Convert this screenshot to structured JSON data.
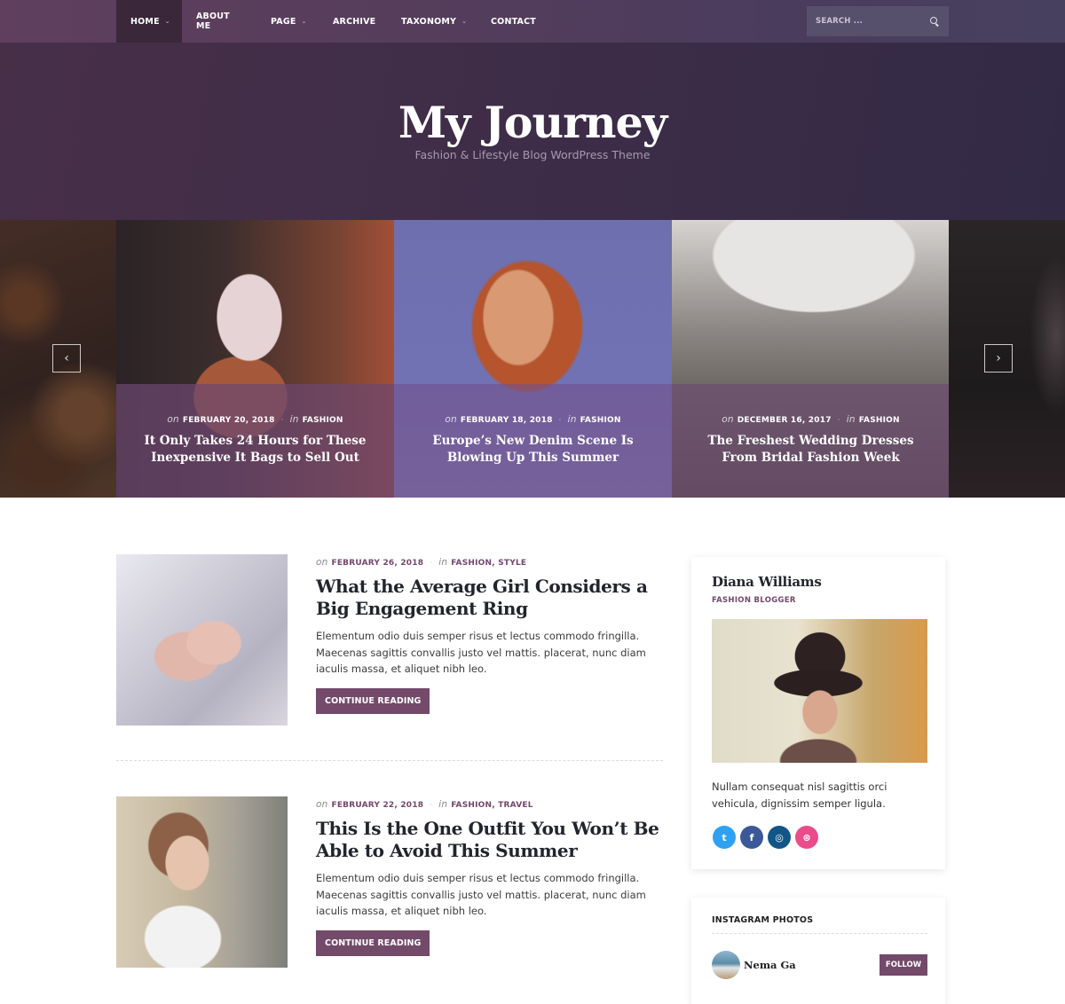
{
  "nav": {
    "items": [
      {
        "label": "HOME",
        "dropdown": true,
        "active": true
      },
      {
        "label": "ABOUT ME",
        "dropdown": false
      },
      {
        "label": "PAGE",
        "dropdown": true
      },
      {
        "label": "ARCHIVE",
        "dropdown": false
      },
      {
        "label": "TAXONOMY",
        "dropdown": true
      },
      {
        "label": "CONTACT",
        "dropdown": false
      }
    ],
    "caret": "⌄",
    "search_placeholder": "SEARCH ...",
    "search_icon": "search-icon"
  },
  "site": {
    "title": "My Journey",
    "tagline": "Fashion & Lifestyle Blog WordPress Theme"
  },
  "slider": {
    "prev_icon": "‹",
    "next_icon": "›",
    "slides": [
      {
        "on": "on",
        "date": "FEBRUARY 20, 2018",
        "in": "in",
        "category": "FASHION",
        "title": "It Only Takes 24 Hours for These Inexpensive It Bags to Sell Out"
      },
      {
        "on": "on",
        "date": "FEBRUARY 18, 2018",
        "in": "in",
        "category": "FASHION",
        "title": "Europe’s New Denim Scene Is Blowing Up This Summer"
      },
      {
        "on": "on",
        "date": "DECEMBER 16, 2017",
        "in": "in",
        "category": "FASHION",
        "title": "The Freshest Wedding Dresses From Bridal Fashion Week"
      }
    ]
  },
  "posts": [
    {
      "on": "on",
      "date": "FEBRUARY 26, 2018",
      "in": "in",
      "categories": "FASHION, STYLE",
      "title": "What the Average Girl Considers a Big Engagement Ring",
      "excerpt": "Elementum odio duis semper risus et lectus commodo fringilla. Maecenas sagittis convallis justo vel mattis. placerat, nunc diam iaculis massa, et aliquet nibh leo.",
      "button": "CONTINUE READING"
    },
    {
      "on": "on",
      "date": "FEBRUARY 22, 2018",
      "in": "in",
      "categories": "FASHION, TRAVEL",
      "title": "This Is the One Outfit You Won’t Be Able to Avoid This Summer",
      "excerpt": "Elementum odio duis semper risus et lectus commodo fringilla. Maecenas sagittis convallis justo vel mattis. placerat, nunc diam iaculis massa, et aliquet nibh leo.",
      "button": "CONTINUE READING"
    }
  ],
  "sidebar": {
    "about": {
      "name": "Diana Williams",
      "role": "FASHION BLOGGER",
      "bio": "Nullam consequat nisl sagittis orci vehicula, dignissim semper ligula.",
      "socials": [
        {
          "name": "twitter",
          "glyph": "t",
          "color": "#2ea1f2"
        },
        {
          "name": "facebook",
          "glyph": "f",
          "color": "#3b5998"
        },
        {
          "name": "instagram",
          "glyph": "◎",
          "color": "#125688"
        },
        {
          "name": "dribbble",
          "glyph": "⊛",
          "color": "#ea4c89"
        }
      ]
    },
    "instagram": {
      "title": "INSTAGRAM PHOTOS",
      "username": "Nema Ga",
      "follow": "FOLLOW"
    }
  },
  "colors": {
    "accent": "#734a6a",
    "header_dark": "#3a2739"
  }
}
